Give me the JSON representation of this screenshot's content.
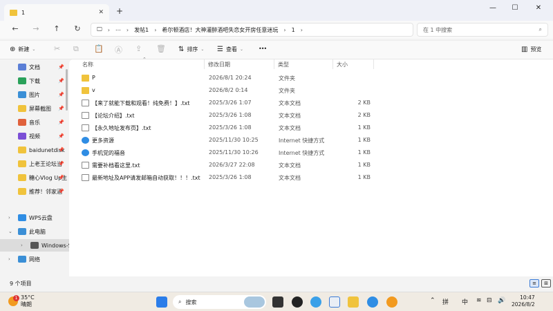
{
  "tab": {
    "title": "1",
    "close_glyph": "✕",
    "new_tab_glyph": "+"
  },
  "window_controls": {
    "minimize": "—",
    "maximize": "☐",
    "close": "✕"
  },
  "nav": {
    "back": "←",
    "forward": "→",
    "up": "↑",
    "refresh": "↻"
  },
  "breadcrumb": {
    "computer_glyph": "🖵",
    "more": "⋯",
    "items": [
      "发帖1",
      "希尔顿酒店！大神灌醉酒吧失恋女开房任意迷玩",
      "1"
    ],
    "sep": "›"
  },
  "search": {
    "placeholder": "在 1 中搜索",
    "icon": "⌕"
  },
  "command_bar": {
    "new_label": "新建",
    "sort_label": "排序",
    "view_label": "查看",
    "more": "•••",
    "details_label": "预览"
  },
  "sidebar": {
    "items": [
      {
        "label": "文档",
        "pinned": true,
        "color": "#5b7fd6"
      },
      {
        "label": "下载",
        "pinned": true,
        "color": "#2aa15a"
      },
      {
        "label": "图片",
        "pinned": true,
        "color": "#3b8fd6"
      },
      {
        "label": "屏幕截图",
        "pinned": true,
        "color": "#f0c33c"
      },
      {
        "label": "音乐",
        "pinned": true,
        "color": "#e0613c"
      },
      {
        "label": "视频",
        "pinned": true,
        "color": "#7b4fd6"
      },
      {
        "label": "baidunetdisk",
        "pinned": true,
        "color": "#f0c33c"
      },
      {
        "label": "上老王论坛当",
        "pinned": true,
        "color": "#f0c33c"
      },
      {
        "label": "糖心Vlog Up主",
        "pinned": true,
        "color": "#f0c33c"
      },
      {
        "label": "推荐！邻家酒",
        "pinned": true,
        "color": "#f0c33c"
      }
    ],
    "tree": [
      {
        "label": "WPS云盘",
        "color": "#2f8de4"
      },
      {
        "label": "此电脑",
        "color": "#3b8fd6"
      },
      {
        "label": "Windows-SSD",
        "color": "#555555"
      },
      {
        "label": "网络",
        "color": "#3b8fd6"
      }
    ]
  },
  "columns": {
    "name": "名称",
    "modified": "修改日期",
    "type": "类型",
    "size": "大小"
  },
  "files": [
    {
      "name": "P",
      "modified": "2026/8/1 20:24",
      "type": "文件夹",
      "size": "",
      "kind": "folder"
    },
    {
      "name": "v",
      "modified": "2026/8/2 0:14",
      "type": "文件夹",
      "size": "",
      "kind": "folder"
    },
    {
      "name": "【来了就能下载和观看！纯免费！】.txt",
      "modified": "2025/3/26 1:07",
      "type": "文本文档",
      "size": "2 KB",
      "kind": "txt"
    },
    {
      "name": "【论坛介绍】.txt",
      "modified": "2025/3/26 1:08",
      "type": "文本文档",
      "size": "2 KB",
      "kind": "txt"
    },
    {
      "name": "【永久地址发布页】.txt",
      "modified": "2025/3/26 1:08",
      "type": "文本文档",
      "size": "1 KB",
      "kind": "txt"
    },
    {
      "name": "更多资源",
      "modified": "2025/11/30 10:25",
      "type": "Internet 快捷方式",
      "size": "1 KB",
      "kind": "link"
    },
    {
      "name": "手机党的福音",
      "modified": "2025/11/30 10:26",
      "type": "Internet 快捷方式",
      "size": "1 KB",
      "kind": "link"
    },
    {
      "name": "需要补档看这里.txt",
      "modified": "2026/3/27 22:08",
      "type": "文本文档",
      "size": "1 KB",
      "kind": "txt"
    },
    {
      "name": "最新地址及APP请发邮箱自动获取！！！.txt",
      "modified": "2025/3/26 1:08",
      "type": "文本文档",
      "size": "1 KB",
      "kind": "txt"
    }
  ],
  "status": {
    "count": "9 个项目"
  },
  "taskbar": {
    "weather_temp": "35°C",
    "weather_desc": "晴朗",
    "weather_badge": "1",
    "search_label": "搜索",
    "tray_ime": "中",
    "tray_glyphs": [
      "⌃",
      "拼",
      "⊞",
      "≋",
      "⊟",
      "🔊"
    ],
    "time": "10:47",
    "date": "2026/8/2"
  }
}
